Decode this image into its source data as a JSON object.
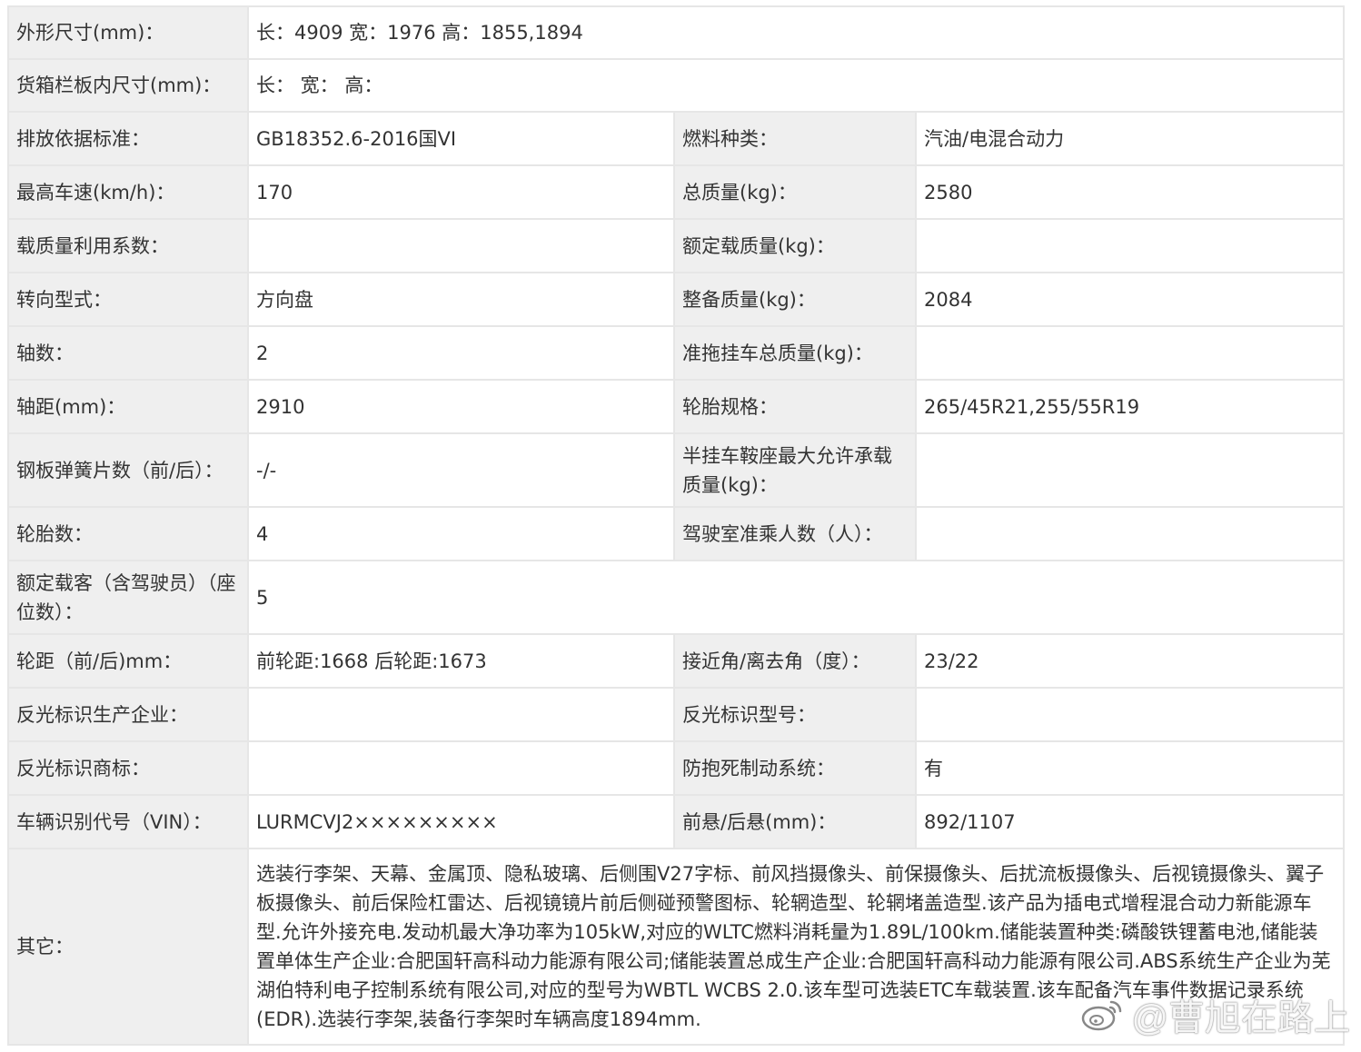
{
  "rows": [
    {
      "l1": "外形尺寸(mm)：",
      "v1": "长：4909 宽：1976 高：1855,1894"
    },
    {
      "l1": "货箱栏板内尺寸(mm)：",
      "v1": "长： 宽： 高："
    },
    {
      "l1": "排放依据标准：",
      "v1": "GB18352.6-2016国VI",
      "l2": "燃料种类：",
      "v2": "汽油/电混合动力"
    },
    {
      "l1": "最高车速(km/h)：",
      "v1": "170",
      "l2": "总质量(kg)：",
      "v2": "2580"
    },
    {
      "l1": "载质量利用系数：",
      "v1": "",
      "l2": "额定载质量(kg)：",
      "v2": ""
    },
    {
      "l1": "转向型式：",
      "v1": "方向盘",
      "l2": "整备质量(kg)：",
      "v2": "2084"
    },
    {
      "l1": "轴数：",
      "v1": "2",
      "l2": "准拖挂车总质量(kg)：",
      "v2": ""
    },
    {
      "l1": "轴距(mm)：",
      "v1": "2910",
      "l2": "轮胎规格：",
      "v2": "265/45R21,255/55R19"
    },
    {
      "l1": "钢板弹簧片数（前/后）：",
      "v1": "-/-",
      "l2": "半挂车鞍座最大允许承载质量(kg)：",
      "v2": ""
    },
    {
      "l1": "轮胎数：",
      "v1": "4",
      "l2": "驾驶室准乘人数（人）：",
      "v2": ""
    },
    {
      "l1": "额定载客（含驾驶员）（座位数）：",
      "v1": "5"
    },
    {
      "l1": "轮距（前/后)mm：",
      "v1": "前轮距:1668 后轮距:1673",
      "l2": "接近角/离去角（度）：",
      "v2": "23/22"
    },
    {
      "l1": "反光标识生产企业：",
      "v1": "",
      "l2": "反光标识型号：",
      "v2": ""
    },
    {
      "l1": "反光标识商标：",
      "v1": "",
      "l2": "防抱死制动系统：",
      "v2": "有"
    },
    {
      "l1": "车辆识别代号（VIN）：",
      "v1": "LURMCVJ2×××××××××",
      "l2": "前悬/后悬(mm)：",
      "v2": "892/1107"
    }
  ],
  "other": {
    "label": "其它：",
    "text": "选装行李架、天幕、金属顶、隐私玻璃、后侧围V27字标、前风挡摄像头、前保摄像头、后扰流板摄像头、后视镜摄像头、翼子板摄像头、前后保险杠雷达、后视镜镜片前后侧碰预警图标、轮辋造型、轮辋堵盖造型.该产品为插电式增程混合动力新能源车型.允许外接充电.发动机最大净功率为105kW,对应的WLTC燃料消耗量为1.89L/100km.储能装置种类:磷酸铁锂蓄电池,储能装置单体生产企业:合肥国轩高科动力能源有限公司;储能装置总成生产企业:合肥国轩高科动力能源有限公司.ABS系统生产企业为芜湖伯特利电子控制系统有限公司,对应的型号为WBTL WCBS 2.0.该车型可选装ETC车载装置.该车配备汽车事件数据记录系统(EDR).选装行李架,装备行李架时车辆高度1894mm."
  },
  "watermark": {
    "text": "@曹旭在路上",
    "icon": "weibo-icon"
  }
}
